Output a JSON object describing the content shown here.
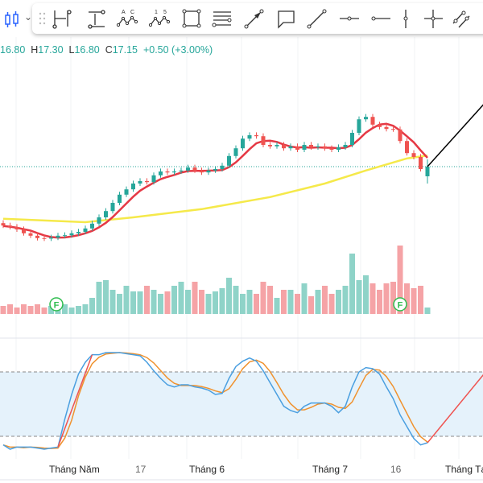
{
  "toolbar": {
    "chart_type_icon": "candlestick-icon",
    "tools": [
      "date-price-range-icon",
      "long-position-icon",
      "abcd-pattern-icon",
      "elliott-wave-icon",
      "rectangle-icon",
      "parallel-channel-icon",
      "arrow-icon",
      "callout-icon",
      "trend-line-icon",
      "horizontal-ray-icon",
      "horizontal-line-icon",
      "vertical-line-icon",
      "cross-line-icon",
      "parallel-lines-icon"
    ],
    "abcd_letters": [
      "A",
      "C"
    ],
    "wave_numbers": [
      "1",
      "5"
    ]
  },
  "legend": {
    "open": "16.80",
    "high_label": "H",
    "high": "17.30",
    "low_label": "L",
    "low": "16.80",
    "close_label": "C",
    "close": "17.15",
    "change": "+0.50 (+3.00%)"
  },
  "colors": {
    "up": "#26a69a",
    "down": "#ef5350",
    "up_vol": "#8fd3c8",
    "down_vol": "#f5a3a6",
    "ma_fast": "#e53945",
    "ma_slow": "#f5e94a",
    "stoch_k": "#4a9fe0",
    "stoch_d": "#f0922e",
    "band": "#e5f2fb",
    "drawing": "#000000"
  },
  "chart_data": {
    "type": "candlestick",
    "title": "",
    "x_tick_labels": [
      {
        "index": 8,
        "label": "Tháng Năm"
      },
      {
        "index": 20,
        "label": "17"
      },
      {
        "index": 30,
        "label": "Tháng 6"
      },
      {
        "index": 48,
        "label": "Tháng 7"
      },
      {
        "index": 57,
        "label": "16"
      },
      {
        "index": 66,
        "label": "Tháng Tám"
      }
    ],
    "last_candle": {
      "open": 16.8,
      "high": 17.3,
      "low": 16.8,
      "close": 17.15
    },
    "first_open": 15.98,
    "closes": [
      15.93,
      15.9,
      15.85,
      15.77,
      15.72,
      15.67,
      15.66,
      15.68,
      15.72,
      15.73,
      15.77,
      15.8,
      15.87,
      15.97,
      16.1,
      16.23,
      16.4,
      16.57,
      16.68,
      16.8,
      16.85,
      16.83,
      16.97,
      17.05,
      17.03,
      17.05,
      17.07,
      17.13,
      17.07,
      17.03,
      17.07,
      17.1,
      17.17,
      17.37,
      17.53,
      17.73,
      17.8,
      17.78,
      17.6,
      17.57,
      17.6,
      17.53,
      17.57,
      17.5,
      17.6,
      17.55,
      17.57,
      17.53,
      17.5,
      17.55,
      17.6,
      17.85,
      18.13,
      18.18,
      18.02,
      17.97,
      17.93,
      17.92,
      17.68,
      17.43,
      17.35,
      17.1,
      17.15
    ],
    "volume": [
      10,
      12,
      8,
      12,
      10,
      12,
      8,
      10,
      10,
      12,
      8,
      10,
      12,
      20,
      40,
      42,
      30,
      25,
      35,
      28,
      28,
      35,
      30,
      25,
      28,
      35,
      40,
      30,
      40,
      30,
      25,
      28,
      32,
      45,
      35,
      25,
      30,
      25,
      40,
      35,
      20,
      30,
      30,
      25,
      38,
      22,
      30,
      35,
      25,
      30,
      35,
      75,
      42,
      48,
      38,
      30,
      38,
      40,
      85,
      38,
      32,
      35,
      8
    ],
    "ma_slow_points": [
      [
        0,
        16.07
      ],
      [
        12,
        16.0
      ],
      [
        19,
        16.1
      ],
      [
        29,
        16.27
      ],
      [
        39,
        16.52
      ],
      [
        47,
        16.8
      ],
      [
        53,
        17.07
      ],
      [
        59,
        17.32
      ],
      [
        62,
        17.38
      ]
    ],
    "ma_fast_period": 5,
    "stochastic": {
      "upper": 80,
      "lower": 20,
      "k": [
        12,
        8,
        10,
        10,
        10,
        9,
        8,
        9,
        10,
        36,
        59,
        78,
        89,
        96,
        96,
        98,
        98,
        98,
        97,
        96,
        95,
        89,
        81,
        74,
        68,
        66,
        68,
        68,
        66,
        65,
        63,
        59,
        60,
        74,
        85,
        90,
        93,
        90,
        81,
        70,
        59,
        48,
        44,
        42,
        48,
        51,
        51,
        51,
        48,
        42,
        48,
        66,
        80,
        84,
        83,
        78,
        66,
        55,
        40,
        29,
        18,
        12,
        14
      ],
      "d_period": 3
    },
    "markers": [
      {
        "index": 8,
        "label": "F"
      },
      {
        "index": 58,
        "label": "F"
      }
    ]
  }
}
